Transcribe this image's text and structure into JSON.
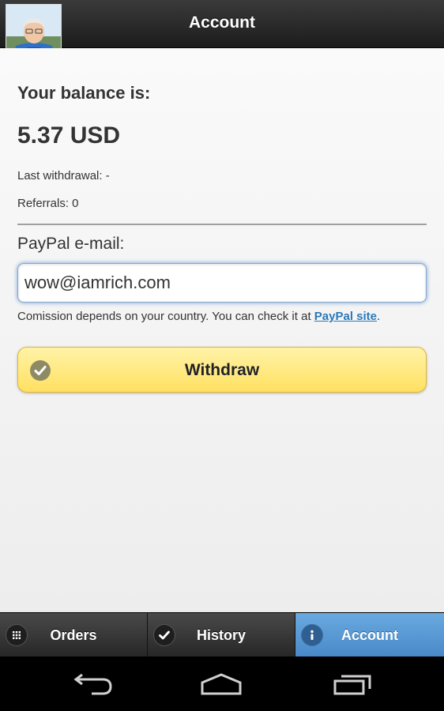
{
  "header": {
    "title": "Account",
    "avatar_icon": "user-avatar"
  },
  "balance": {
    "label": "Your balance is:",
    "value": "5.37 USD",
    "last_withdrawal": "Last withdrawal: -",
    "referrals": "Referrals: 0"
  },
  "paypal": {
    "label": "PayPal e-mail:",
    "email_value": "wow@iamrich.com",
    "note_prefix": "Comission depends on your country. You can check it at ",
    "note_link": "PayPal site",
    "note_suffix": "."
  },
  "withdraw": {
    "label": "Withdraw",
    "icon": "check-circle-icon"
  },
  "tabs": [
    {
      "label": "Orders",
      "icon": "grid-icon",
      "active": false
    },
    {
      "label": "History",
      "icon": "check-icon",
      "active": false
    },
    {
      "label": "Account",
      "icon": "info-icon",
      "active": true
    }
  ],
  "colors": {
    "header_bg": "#262626",
    "button_yellow": "#ffe060",
    "active_tab_blue": "#4888c8",
    "link_blue": "#2a7ab8"
  },
  "system_nav": [
    "back-icon",
    "home-icon",
    "recents-icon"
  ]
}
